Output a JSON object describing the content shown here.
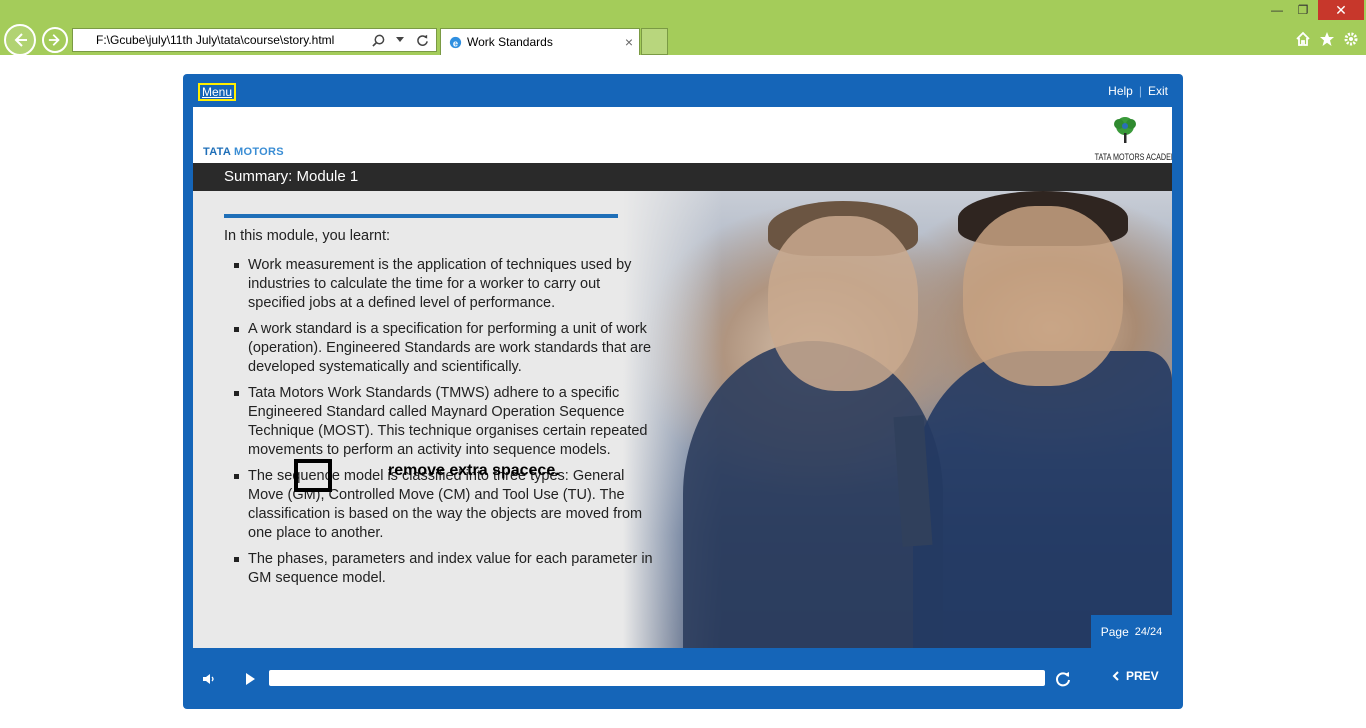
{
  "browser": {
    "url": "F:\\Gcube\\july\\11th July\\tata\\course\\story.html",
    "tab_title": "Work Standards",
    "tab_close": "×"
  },
  "player": {
    "menu_label": "Menu",
    "help_label": "Help",
    "separator": "|",
    "exit_label": "Exit"
  },
  "brand": {
    "left_part1": "TATA",
    "left_part2": "MOTORS",
    "right": "TATA MOTORS ACADEMY"
  },
  "slide": {
    "title": "Summary: Module 1",
    "intro": "In this module, you learnt:",
    "bullets": [
      "Work measurement is the application of techniques used by industries to calculate the time for a worker to carry out specified jobs at a defined level of performance.",
      "A work standard is a specification for performing a unit of work (operation). Engineered Standards are work standards that are developed systematically and scientifically.",
      "Tata Motors Work Standards (TMWS) adhere to a specific Engineered Standard called Maynard Operation Sequence Technique (MOST). This technique organises certain repeated movements to perform an activity into sequence models.",
      "The sequence model is classified into three types: General Move (GM), Controlled Move (CM) and Tool Use (TU). The classification is based on the way the objects are moved from one place to another.",
      "The phases, parameters and index value for each parameter in GM sequence model."
    ],
    "annotation": "remove extra spacece.",
    "page_label": "Page",
    "page_count": "24/24"
  },
  "controls": {
    "prev_label": "PREV",
    "progress_fraction": 1.0
  },
  "colors": {
    "chrome": "#a4cc5a",
    "player_blue": "#1565b8",
    "title_bar": "#2a2a2a",
    "annotation_highlight": "#ffee00"
  }
}
